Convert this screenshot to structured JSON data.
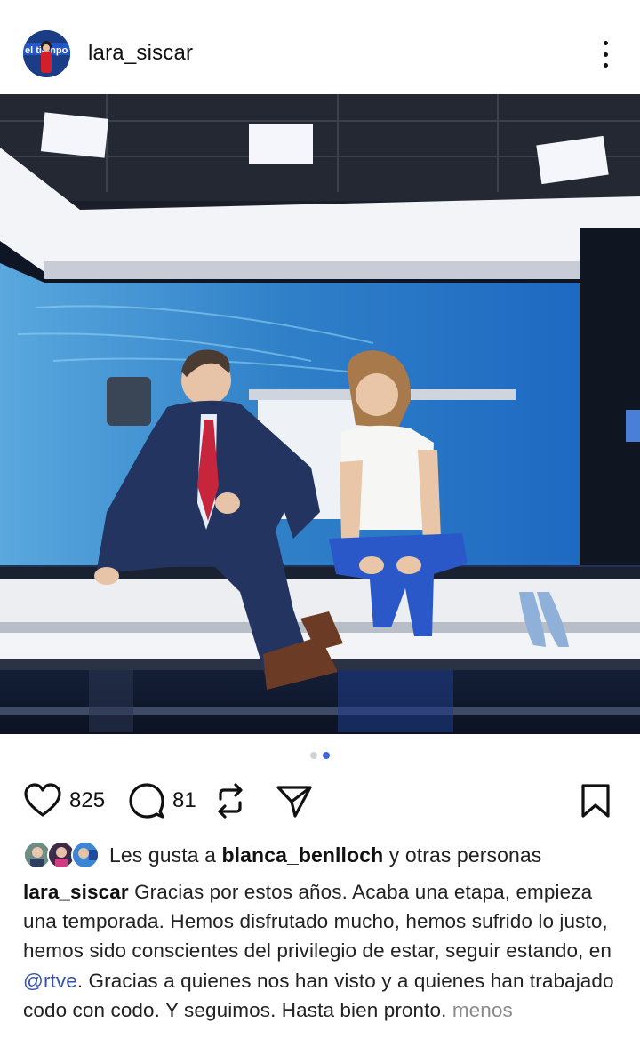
{
  "post": {
    "username": "lara_siscar",
    "avatar_label": "el tiempo",
    "photo_description_icon": "studio-photo",
    "carousel": {
      "total": 2,
      "active_index": 2
    }
  },
  "actions": {
    "likes_count": "825",
    "comments_count": "81"
  },
  "liked_by": {
    "prefix": "Les gusta a ",
    "user": "blanca_benlloch",
    "suffix": " y otras personas"
  },
  "caption": {
    "user": "lara_siscar",
    "text_1": " Gracias por estos años. Acaba una etapa, empieza una temporada. Hemos disfrutado mucho, hemos sufrido lo justo, hemos sido conscientes del privilegio de estar, seguir estando, en ",
    "mention": "@rtve",
    "text_2": ". Gracias a quienes nos han visto y a quienes han trabajado codo con codo. Y seguimos. Hasta bien pronto. ",
    "less_link": "menos"
  },
  "colors": {
    "accent": "#3b64e0",
    "mention": "#3451b2",
    "muted": "#8a8a8a"
  }
}
